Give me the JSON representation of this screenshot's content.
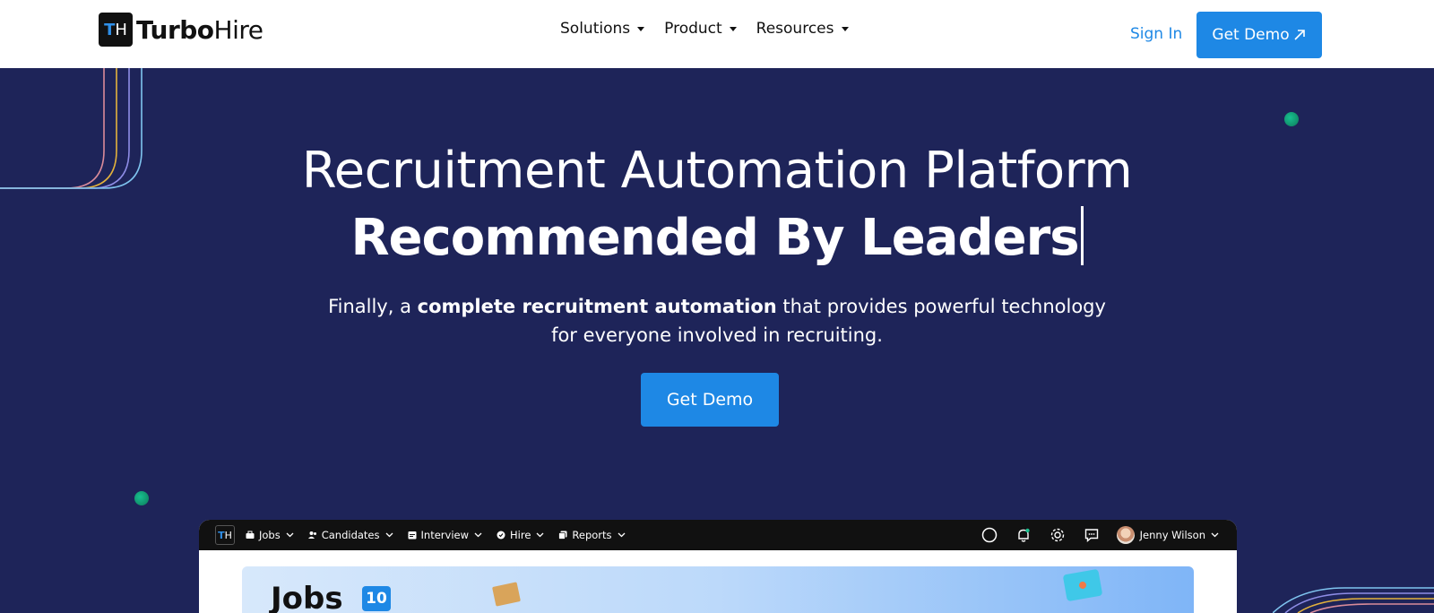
{
  "header": {
    "logo": {
      "mark_t": "T",
      "mark_h": "H",
      "brand_bold": "Turbo",
      "brand_regular": "Hire"
    },
    "nav": [
      {
        "label": "Solutions"
      },
      {
        "label": "Product"
      },
      {
        "label": "Resources"
      }
    ],
    "sign_in": "Sign In",
    "get_demo": "Get Demo"
  },
  "hero": {
    "title_line1": "Recruitment Automation Platform",
    "title_line2": "Recommended By Leaders",
    "subtitle_prefix": "Finally, a ",
    "subtitle_bold": "complete recruitment automation",
    "subtitle_suffix": " that provides powerful technology",
    "subtitle_line2": "for everyone involved in recruiting.",
    "cta": "Get Demo"
  },
  "app_preview": {
    "logo": {
      "mark_t": "T",
      "mark_h": "H"
    },
    "menu": [
      {
        "label": "Jobs",
        "icon": "briefcase-icon"
      },
      {
        "label": "Candidates",
        "icon": "users-icon"
      },
      {
        "label": "Interview",
        "icon": "calendar-icon"
      },
      {
        "label": "Hire",
        "icon": "badge-icon"
      },
      {
        "label": "Reports",
        "icon": "reports-icon"
      }
    ],
    "user_name": "Jenny Wilson",
    "page_title": "Jobs",
    "jobs_count": "10"
  },
  "colors": {
    "hero_bg": "#1e2459",
    "accent": "#1e88e5",
    "header_bg": "#ffffff"
  }
}
